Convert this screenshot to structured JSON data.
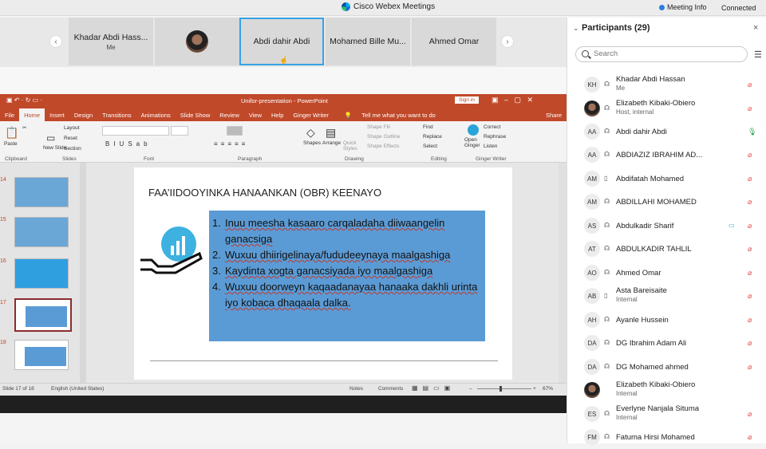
{
  "window": {
    "title": "Cisco Webex Meetings",
    "meeting_info": "Meeting Info",
    "status": "Connected"
  },
  "strip": {
    "tiles": [
      {
        "name": "Khadar Abdi Hass...",
        "sub": "Me"
      },
      {
        "name": "",
        "sub": ""
      },
      {
        "name": "Abdi dahir Abdi",
        "sub": ""
      },
      {
        "name": "Mohamed Bille Mu...",
        "sub": ""
      },
      {
        "name": "Ahmed Omar",
        "sub": ""
      }
    ],
    "prev": "‹",
    "next": "›"
  },
  "ppt": {
    "title": "Unifor-presentation  -  PowerPoint",
    "sign_in": "Sign in",
    "share": "Share",
    "tabs": [
      "File",
      "Home",
      "Insert",
      "Design",
      "Transitions",
      "Animations",
      "Slide Show",
      "Review",
      "View",
      "Help",
      "Ginger Writer"
    ],
    "tell_me": "Tell me what you want to do",
    "groups": [
      "Clipboard",
      "Slides",
      "Font",
      "Paragraph",
      "Drawing",
      "Editing",
      "Ginger Writer"
    ],
    "ribbon_items": {
      "paste": "Paste",
      "new_slide": "New Slide",
      "layout": "Layout",
      "reset": "Reset",
      "section": "Section",
      "shapes": "Shapes",
      "arrange": "Arrange",
      "quick_styles": "Quick Styles",
      "shape_fill": "Shape Fill",
      "shape_outline": "Shape Outline",
      "shape_effects": "Shape Effects",
      "find": "Find",
      "replace": "Replace",
      "select": "Select",
      "open_ginger": "Open Ginger",
      "correct": "Correct",
      "rephrase": "Rephrase",
      "listen": "Listen"
    },
    "thumb_numbers": [
      "14",
      "15",
      "16",
      "17",
      "18"
    ],
    "slide": {
      "title": "FAA’IIDOOYINKA HANAANKAN (OBR) KEENAYO",
      "items": [
        {
          "n": "1.",
          "t": "Inuu meesha kasaaro carqaladaha diiwaangelin ganacsiga"
        },
        {
          "n": "2.",
          "t": "Wuxuu dhiirigelinaya/fududeeynaya maalgashiga"
        },
        {
          "n": "3.",
          "t": "Kaydinta xogta ganacsiyada iyo maalgashiga"
        },
        {
          "n": "4.",
          "t": "Wuxuu doorweyn kaqaadanayaa hanaaka dakhli urinta iyo kobaca dhaqaala dalka."
        }
      ]
    },
    "status": {
      "slide": "Slide 17 of 18",
      "lang": "English (United States)",
      "notes": "Notes",
      "comments": "Comments",
      "zoom": "67%"
    }
  },
  "panel": {
    "title": "Participants (29)",
    "search_placeholder": "Search",
    "participants": [
      {
        "initials": "KH",
        "name": "Khadar Abdi Hassan",
        "sub": "Me",
        "device": "headset",
        "mic": "muted",
        "photo": false
      },
      {
        "initials": "",
        "name": "Elizabeth Kibaki-Obiero",
        "sub": "Host, internal",
        "device": "headset",
        "mic": "muted",
        "photo": true
      },
      {
        "initials": "AA",
        "name": "Abdi dahir Abdi",
        "sub": "",
        "device": "headset",
        "mic": "on",
        "photo": false
      },
      {
        "initials": "AA",
        "name": "ABDIAZIZ IBRAHIM AD...",
        "sub": "",
        "device": "headset",
        "mic": "muted",
        "photo": false
      },
      {
        "initials": "AM",
        "name": "Abdifatah Mohamed",
        "sub": "",
        "device": "phone",
        "mic": "muted",
        "photo": false
      },
      {
        "initials": "AM",
        "name": "ABDILLAHI MOHAMED",
        "sub": "",
        "device": "headset",
        "mic": "muted",
        "photo": false
      },
      {
        "initials": "AS",
        "name": "Abdulkadir Sharif",
        "sub": "",
        "device": "headset",
        "mic": "muted",
        "photo": false,
        "camera": true
      },
      {
        "initials": "AT",
        "name": "ABDULKADIR TAHLIL",
        "sub": "",
        "device": "headset",
        "mic": "muted",
        "photo": false
      },
      {
        "initials": "AO",
        "name": "Ahmed Omar",
        "sub": "",
        "device": "headset",
        "mic": "muted",
        "photo": false
      },
      {
        "initials": "AB",
        "name": "Asta Bareisaite",
        "sub": "Internal",
        "device": "phone",
        "mic": "muted",
        "photo": false
      },
      {
        "initials": "AH",
        "name": "Ayanle Hussein",
        "sub": "",
        "device": "headset",
        "mic": "muted",
        "photo": false
      },
      {
        "initials": "DA",
        "name": "DG Ibrahim Adam Ali",
        "sub": "",
        "device": "headset",
        "mic": "muted",
        "photo": false
      },
      {
        "initials": "DA",
        "name": "DG Mohamed ahmed",
        "sub": "",
        "device": "headset",
        "mic": "muted",
        "photo": false
      },
      {
        "initials": "",
        "name": "Elizabeth Kibaki-Obiero",
        "sub": "Internal",
        "device": "",
        "mic": "",
        "photo": true
      },
      {
        "initials": "ES",
        "name": "Everlyne Nanjala Situma",
        "sub": "Internal",
        "device": "headset",
        "mic": "muted",
        "photo": false
      },
      {
        "initials": "FM",
        "name": "Fatuma Hirsi Mohamed",
        "sub": "",
        "device": "headset",
        "mic": "muted",
        "photo": false
      }
    ]
  }
}
